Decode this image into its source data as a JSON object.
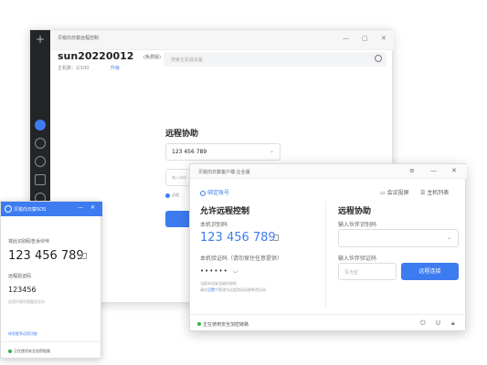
{
  "back_window": {
    "app_title": "贝锐向日葵远程控制",
    "controls": [
      "—",
      "▢",
      "✕"
    ],
    "username": "sun20220012",
    "edition": "(免费版)",
    "host_info": "主机数：2/100",
    "upgrade_link": "升级",
    "search_placeholder": "搜索主机或设备",
    "remote_title": "远程协助",
    "remote_id": "123 456 789",
    "remote_input_placeholder": "输入伙伴",
    "remote_check": "远程",
    "rail_icons": [
      "plus-icon",
      "chat-icon",
      "clock-icon",
      "globe-icon",
      "grid-icon",
      "shield-icon"
    ]
  },
  "sos_window": {
    "title": "贝锐向日葵SOS",
    "controls": [
      "—",
      "✕"
    ],
    "share_label": "将此识别码告诉伙伴",
    "code": "123 456 789",
    "password_label": "远程验证码",
    "password": "123456",
    "note": "远程时请勿透露验证码",
    "link": "体验更多远程功能",
    "status": "正在使用安全加密链路"
  },
  "enterprise_window": {
    "title": "贝锐向日葵客户端·企业版",
    "controls": [
      "≡",
      "—",
      "✕"
    ],
    "bind_label": "绑定账号",
    "meeting_label": "会议投屏",
    "host_list_label": "主机列表",
    "allow_title": "允许远程控制",
    "id_label": "本机识别码",
    "code": "123 456 789",
    "password_label": "本机验证码（请勿保住任意提供）",
    "password_mask": "••••••",
    "note_line1": "当前本机安全级别较低",
    "note_line2_prefix": "请在",
    "note_line2_link": "设置",
    "note_line2_suffix": "中更改为远程验证码更新验证码",
    "remote_title": "远程协助",
    "partner_id_label": "输入伙伴识别码",
    "partner_pw_label": "输入伙伴验证码",
    "partner_pw_placeholder": "写为空",
    "connect_button": "远程连接",
    "status": "正在使用安全加密链路",
    "footer_icons": [
      "power-icon",
      "u-icon",
      "lock-icon"
    ]
  },
  "colors": {
    "accent": "#3d7cf0",
    "rail": "#232529",
    "status_green": "#2fb344"
  }
}
